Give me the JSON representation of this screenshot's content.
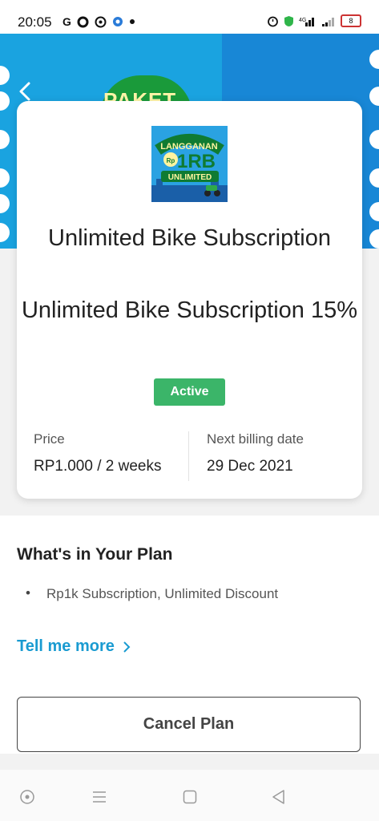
{
  "status_bar": {
    "time": "20:05",
    "left_icons": [
      "google-icon",
      "circle-app-icon",
      "whatsapp-icon",
      "location-icon",
      "dot-icon"
    ],
    "right_icons": [
      "alarm-icon",
      "shield-icon",
      "signal-4g-icon",
      "signal-icon",
      "battery-icon"
    ],
    "battery_level": "8"
  },
  "hero": {
    "badge_text": "PAKET",
    "colors": {
      "left": "#1aa3e0",
      "right": "#1887d6"
    }
  },
  "card": {
    "plan_image": {
      "line1": "LANGGANAN",
      "badge": "Rp",
      "big": "1RB",
      "line2": "UNLIMITED"
    },
    "title": "Unlimited Bike Subscription",
    "subtitle": "Unlimited Bike Subscription 15%",
    "status": "Active",
    "price_label": "Price",
    "price_value": "RP1.000 / 2 weeks",
    "billing_label": "Next billing date",
    "billing_value": "29 Dec 2021"
  },
  "plan_section": {
    "heading": "What's in Your Plan",
    "items": [
      "Rp1k Subscription, Unlimited Discount"
    ],
    "tell_more": "Tell me more"
  },
  "cancel_button": "Cancel Plan",
  "nav_bar": [
    "assistant-icon",
    "menu-icon",
    "home-icon",
    "back-icon"
  ],
  "colors": {
    "accent": "#1a9bd1",
    "active_badge": "#3bb569"
  }
}
